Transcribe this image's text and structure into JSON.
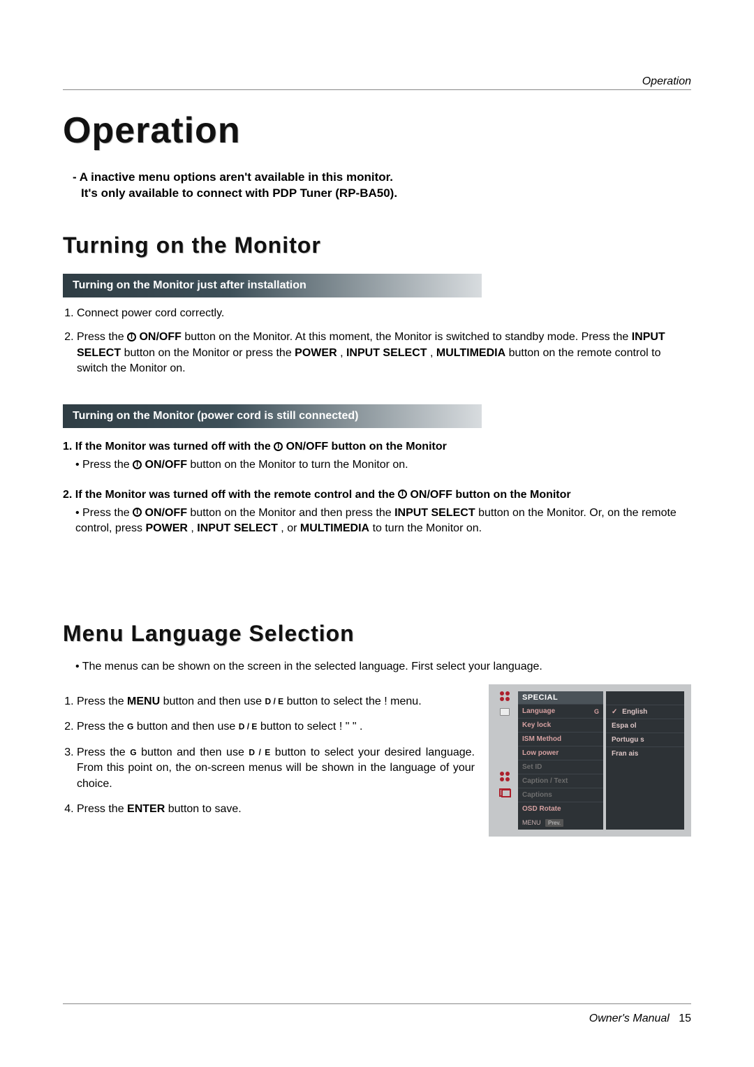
{
  "header": {
    "section": "Operation"
  },
  "chapter_title": "Operation",
  "note_line1": "- A inactive menu options aren't available in this monitor.",
  "note_line2": "It's only available to connect with PDP Tuner (RP-BA50).",
  "section1": {
    "title": "Turning on the Monitor",
    "sub1": "Turning on the Monitor just after installation",
    "step1": "Connect power cord correctly.",
    "step2a": "Press the ",
    "step2b": " ON/OFF",
    "step2c": " button on the Monitor. At this moment, the Monitor is switched to standby mode. Press the ",
    "step2d": "INPUT SELECT",
    "step2e": " button on the Monitor or press the ",
    "step2f": "POWER",
    "step2g": ", ",
    "step2h": "INPUT SELECT",
    "step2i": ", ",
    "step2j": "MULTIMEDIA",
    "step2k": " button on the remote control to switch the Monitor on.",
    "sub2": "Turning on the Monitor (power cord is still connected)",
    "case1_title_a": "1. If the Monitor was turned off with the ",
    "case1_title_b": " ON/OFF button on the Monitor",
    "case1_bullet_a": "Press the ",
    "case1_bullet_b": " ON/OFF",
    "case1_bullet_c": " button on the Monitor to turn the Monitor on.",
    "case2_title_a": "2. If the Monitor was turned off  with the remote control and the ",
    "case2_title_b": " ON/OFF button on the Monitor",
    "case2_bullet_a": "Press the ",
    "case2_bullet_b": "ON/OFF",
    "case2_bullet_c": " button on the Monitor and then press the ",
    "case2_bullet_d": "INPUT SELECT",
    "case2_bullet_e": "  button on the Monitor. Or, on the remote control, press ",
    "case2_bullet_f": "POWER",
    "case2_bullet_g": ", ",
    "case2_bullet_h": "INPUT SELECT",
    "case2_bullet_i": ", or ",
    "case2_bullet_j": "MULTIMEDIA",
    "case2_bullet_k": " to turn the Monitor on."
  },
  "section2": {
    "title": "Menu Language Selection",
    "intro": "The menus can be shown on the screen in the selected language. First select your language.",
    "s1a": "Press the ",
    "s1b": "MENU",
    "s1c": " button and then use ",
    "s1d": " button to select the ",
    "s1e": " menu.",
    "s2a": "Press the ",
    "s2b": " button and then use ",
    "s2c": "  button to select ",
    "s2d": ".",
    "s3a": "Press the ",
    "s3b": " button and then use ",
    "s3c": " button to select your desired language. From this point on, the on-screen menus will be shown in the language of your choice.",
    "s4a": "Press the ",
    "s4b": "ENTER",
    "s4c": " button to save.",
    "key_de": "D  / E",
    "key_g": "G",
    "blank_menu": "      !      ",
    "blank_item": "! \"   \"     "
  },
  "osd": {
    "title": "SPECIAL",
    "items": {
      "language": "Language",
      "g": "G",
      "keylock": "Key lock",
      "ism": "ISM Method",
      "lowpower": "Low power",
      "setid": "Set ID",
      "captiontext": "Caption / Text",
      "captions": "Captions",
      "osdrotate": "OSD Rotate"
    },
    "options": {
      "english": "English",
      "espanol": "Espa ol",
      "portugues": "Portugu s",
      "francais": "Fran ais",
      "check": "✓"
    },
    "footer": {
      "menu": "MENU",
      "prev": "Prev."
    }
  },
  "footer": {
    "label": "Owner's Manual",
    "page": "15"
  }
}
